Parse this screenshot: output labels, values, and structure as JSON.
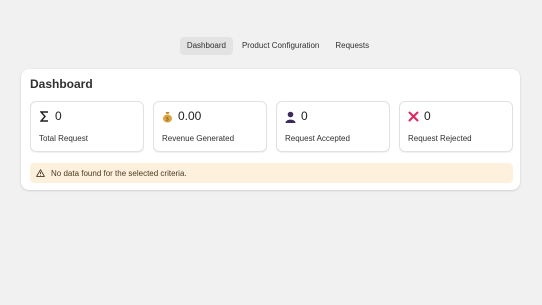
{
  "nav": {
    "tabs": [
      {
        "label": "Dashboard",
        "active": true
      },
      {
        "label": "Product Configuration",
        "active": false
      },
      {
        "label": "Requests",
        "active": false
      }
    ]
  },
  "dashboard": {
    "title": "Dashboard",
    "stats": [
      {
        "icon": "sigma-icon",
        "value": "0",
        "label": "Total Request"
      },
      {
        "icon": "money-bag-icon",
        "value": "0.00",
        "label": "Revenue Generated"
      },
      {
        "icon": "person-icon",
        "value": "0",
        "label": "Request Accepted"
      },
      {
        "icon": "cross-mark-icon",
        "value": "0",
        "label": "Request Rejected"
      }
    ],
    "banner": {
      "icon": "warning-icon",
      "text": "No data found for the selected criteria."
    }
  },
  "colors": {
    "background": "#f1f1f1",
    "card": "#ffffff",
    "tab_active": "#e3e3e3",
    "banner_bg": "#fdf0dd",
    "person_icon": "#3d2a5c",
    "cross_icon": "#e0245e",
    "bag_icon": "#d9a441"
  }
}
